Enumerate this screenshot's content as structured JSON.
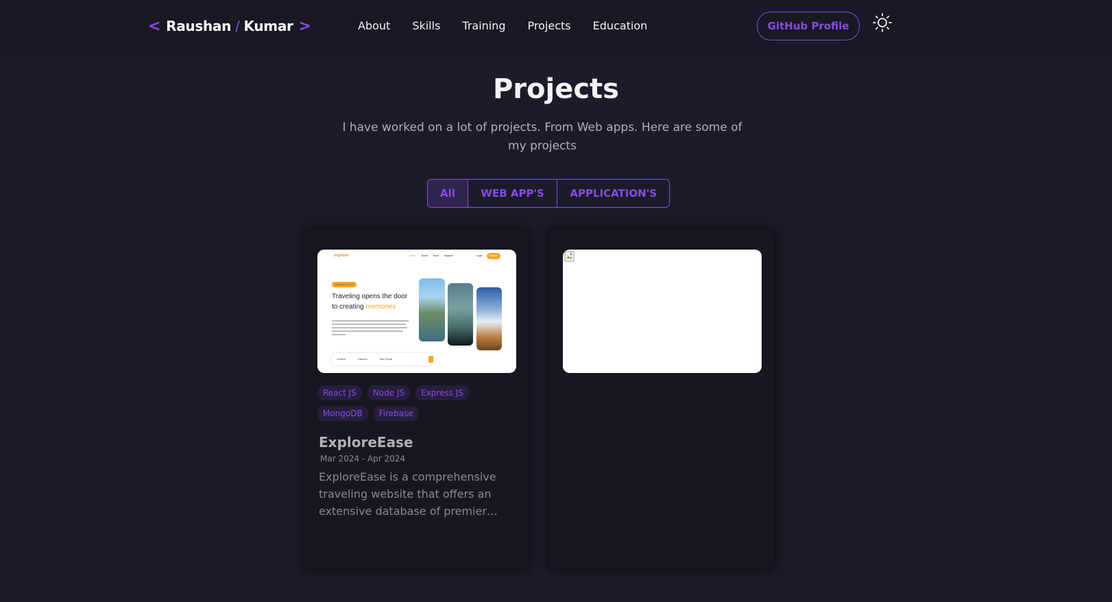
{
  "nav": {
    "logo": {
      "open_bracket": "<",
      "first": "Raushan",
      "slash": "/",
      "last": "Kumar",
      "close_bracket": ">"
    },
    "links": [
      "About",
      "Skills",
      "Training",
      "Projects",
      "Education"
    ],
    "github_label": "GitHub Profile",
    "theme_icon": "sun-icon"
  },
  "header": {
    "title": "Projects",
    "description": "I have worked on a lot of projects. From Web apps. Here are some of my projects"
  },
  "filters": {
    "items": [
      "All",
      "WEB APP'S",
      "APPLICATION'S"
    ],
    "active": "All"
  },
  "projects": [
    {
      "preview": {
        "logo": "explore",
        "nav_items": [
          "Home",
          "About",
          "Tours",
          "Support"
        ],
        "login": "Login",
        "signup": "Register",
        "badge": "Know Before You Go",
        "headline_1": "Traveling opens the door",
        "headline_2a": "to creating",
        "headline_2b": "memories",
        "search_fields": [
          "Location",
          "Distance",
          "Max People"
        ]
      },
      "tags": [
        "React JS",
        "Node JS",
        "Express JS",
        "MongoDB",
        "Firebase"
      ],
      "title": "ExploreEase",
      "date": "Mar 2024 - Apr 2024",
      "description": "ExploreEase is a comprehensive traveling website that offers an extensive database of premier tourist destinations"
    },
    {
      "tags": [],
      "title": "",
      "date": "",
      "description": ""
    }
  ],
  "colors": {
    "primary": "#854ce6",
    "background": "#1c1b29",
    "card": "#171721",
    "text_primary": "#f2f3f4",
    "text_secondary": "#b1b2b3"
  }
}
